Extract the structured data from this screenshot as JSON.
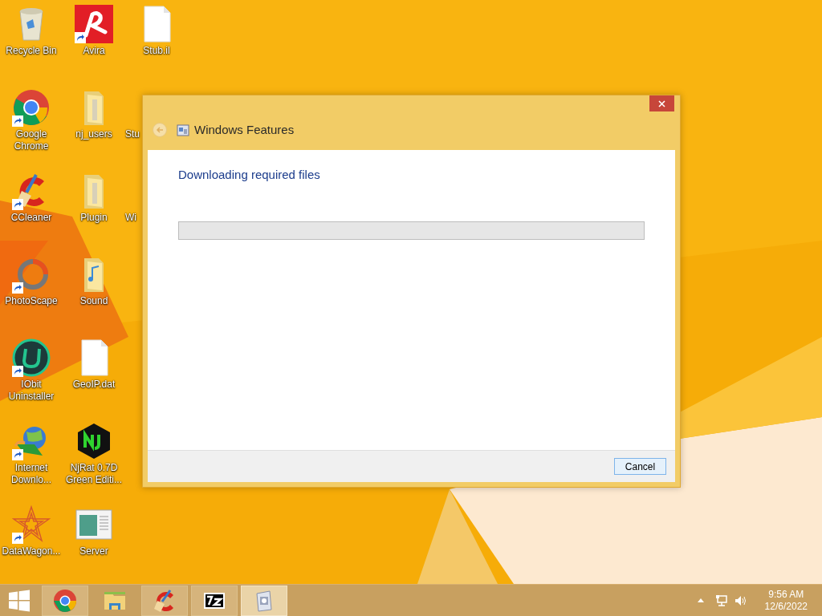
{
  "desktop": {
    "columns": [
      [
        {
          "label": "Recycle Bin",
          "kind": "recycle",
          "shortcut": false
        },
        {
          "label": "Google Chrome",
          "kind": "chrome",
          "shortcut": true
        },
        {
          "label": "CCleaner",
          "kind": "ccleaner",
          "shortcut": true
        },
        {
          "label": "PhotoScape",
          "kind": "photoscape",
          "shortcut": true
        },
        {
          "label": "IObit Uninstaller",
          "kind": "iobit",
          "shortcut": true
        },
        {
          "label": "Internet Downlo...",
          "kind": "idm",
          "shortcut": true
        },
        {
          "label": "DataWagon...",
          "kind": "star",
          "shortcut": true
        }
      ],
      [
        {
          "label": "Avira",
          "kind": "avira",
          "shortcut": true
        },
        {
          "label": "nj_users",
          "kind": "folder",
          "shortcut": false
        },
        {
          "label": "Plugin",
          "kind": "folder",
          "shortcut": false
        },
        {
          "label": "Sound",
          "kind": "music-folder",
          "shortcut": false
        },
        {
          "label": "GeoIP.dat",
          "kind": "file",
          "shortcut": false
        },
        {
          "label": "NjRat 0.7D Green Editi...",
          "kind": "njrat",
          "shortcut": false
        },
        {
          "label": "Server",
          "kind": "app-window",
          "shortcut": false
        }
      ],
      [
        {
          "label": "Stub.il",
          "kind": "file",
          "shortcut": false
        },
        {
          "label": "Stu",
          "kind": "hidden"
        },
        {
          "label": "Wi",
          "kind": "hidden"
        }
      ]
    ]
  },
  "dialog": {
    "title": "Windows Features",
    "heading": "Downloading required files",
    "progress": {
      "level": 0
    },
    "buttons": [
      "Cancel"
    ]
  },
  "taskbar": {
    "items": [
      {
        "kind": "start"
      },
      {
        "kind": "chrome",
        "running": true,
        "selected": false
      },
      {
        "kind": "explorer",
        "running": false,
        "selected": false
      },
      {
        "kind": "ccleaner",
        "running": true,
        "selected": false
      },
      {
        "kind": "sevenzip",
        "running": true,
        "selected": false
      },
      {
        "kind": "setup",
        "running": true,
        "selected": true
      }
    ],
    "clock": {
      "time": "9:56 AM",
      "date": "12/6/2022"
    }
  }
}
